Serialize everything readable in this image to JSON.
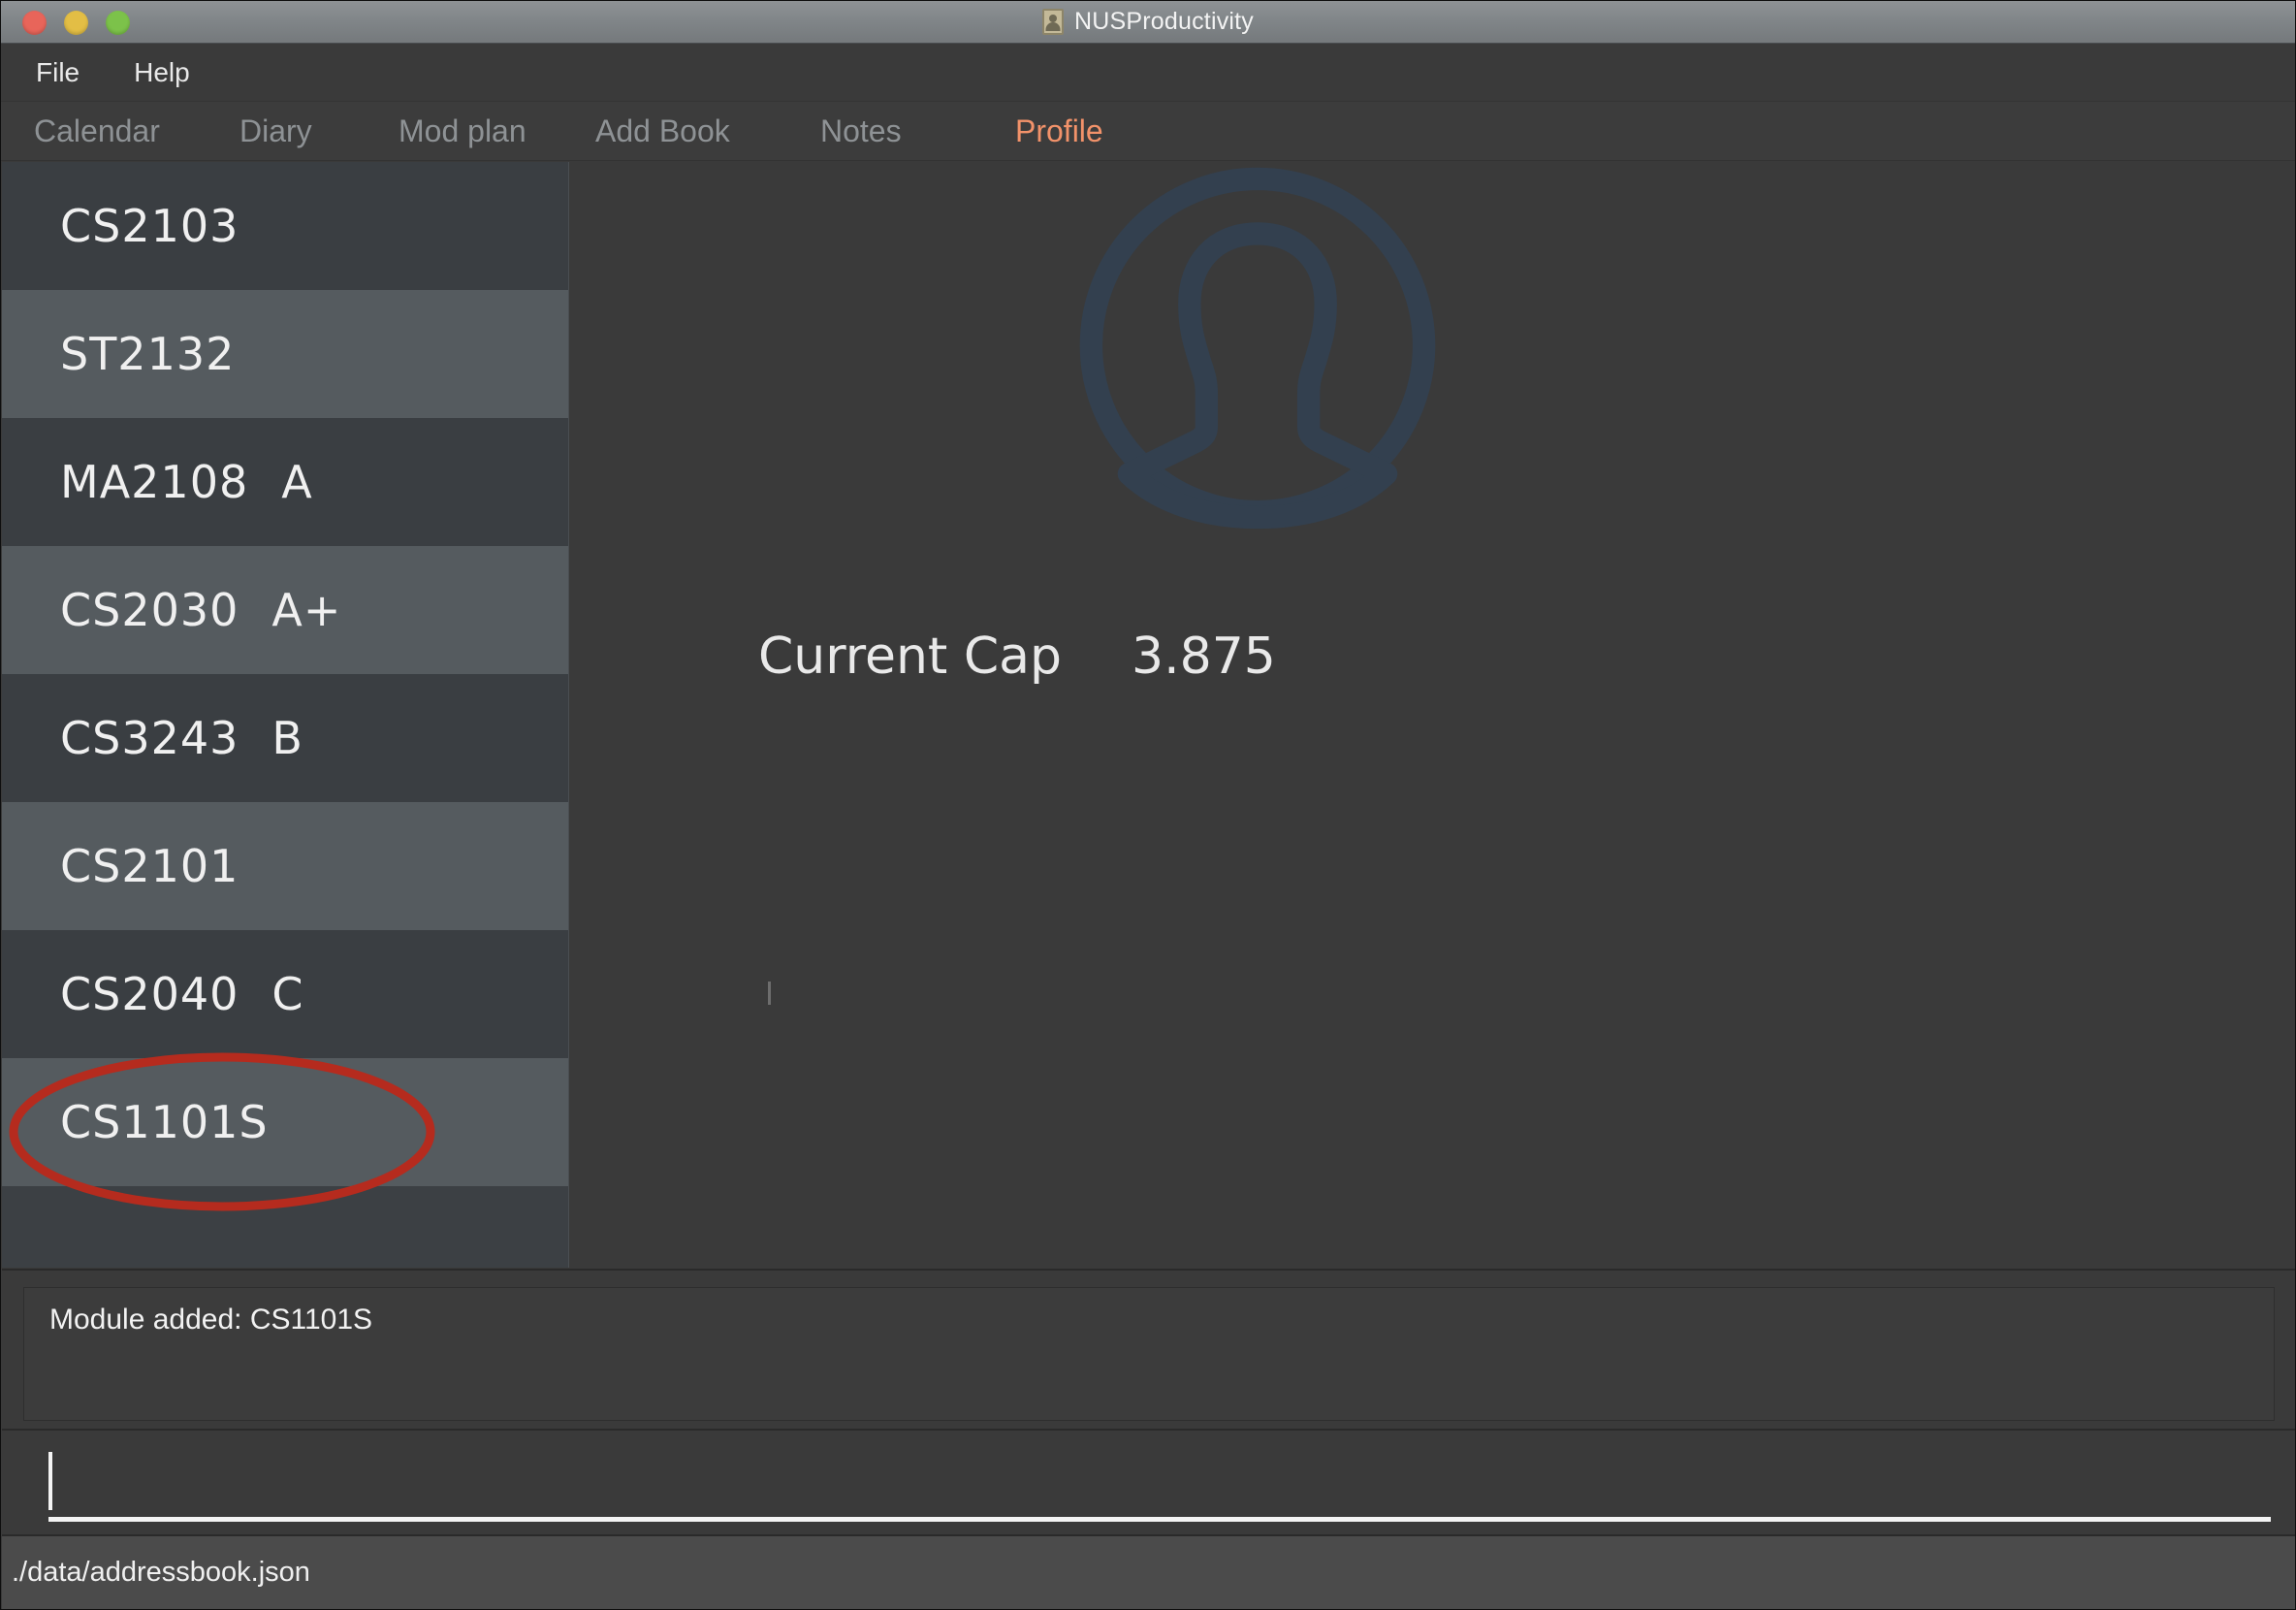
{
  "window": {
    "title": "NUSProductivity",
    "title_icon": "address-book-icon",
    "traffic_lights": [
      {
        "name": "close",
        "color": "#e8655a"
      },
      {
        "name": "minimize",
        "color": "#e3be45"
      },
      {
        "name": "maximize",
        "color": "#7cc24a"
      }
    ]
  },
  "menubar": {
    "items": [
      {
        "label": "File"
      },
      {
        "label": "Help"
      }
    ]
  },
  "tabs": {
    "active": "Profile",
    "active_color": "#f2926a",
    "inactive_color": "#8e9295",
    "items": [
      {
        "label": "Calendar",
        "active": false
      },
      {
        "label": "Diary",
        "active": false
      },
      {
        "label": "Mod plan",
        "active": false
      },
      {
        "label": "Add Book",
        "active": false
      },
      {
        "label": "Notes",
        "active": false
      },
      {
        "label": "Profile",
        "active": true
      }
    ]
  },
  "module_list": {
    "rows": [
      {
        "code": "CS2103",
        "grade": ""
      },
      {
        "code": "ST2132",
        "grade": ""
      },
      {
        "code": "MA2108",
        "grade": "A"
      },
      {
        "code": "CS2030",
        "grade": "A+"
      },
      {
        "code": "CS3243",
        "grade": "B"
      },
      {
        "code": "CS2101",
        "grade": ""
      },
      {
        "code": "CS2040",
        "grade": "C"
      },
      {
        "code": "CS1101S",
        "grade": ""
      }
    ]
  },
  "profile": {
    "avatar_icon": "user-avatar-icon",
    "avatar_color": "#33404f",
    "cap_label": "Current Cap",
    "cap_value": "3.875"
  },
  "result_panel": {
    "message": "Module added: CS1101S"
  },
  "command_input": {
    "value": "",
    "placeholder": ""
  },
  "statusbar": {
    "file_path": "./data/addressbook.json"
  },
  "annotation": {
    "shape": "ellipse",
    "color": "#b52b1e",
    "target": "CS1101S"
  }
}
